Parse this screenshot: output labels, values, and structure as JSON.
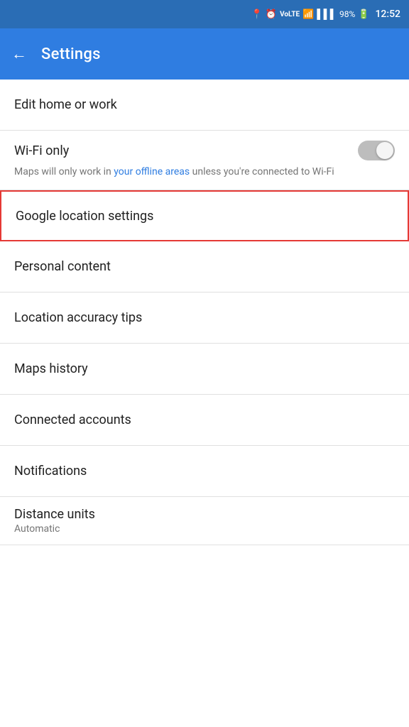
{
  "statusBar": {
    "battery": "98%",
    "time": "12:52"
  },
  "appBar": {
    "title": "Settings",
    "backLabel": "←"
  },
  "menuItems": [
    {
      "id": "edit-home-work",
      "label": "Edit home or work",
      "type": "simple"
    },
    {
      "id": "wifi-only",
      "label": "Wi-Fi only",
      "type": "toggle",
      "description": "Maps will only work in your offline areas unless you're connected to Wi-Fi",
      "descriptionLinkText": "your offline areas",
      "toggleOn": false
    },
    {
      "id": "google-location-settings",
      "label": "Google location settings",
      "type": "highlighted"
    },
    {
      "id": "personal-content",
      "label": "Personal content",
      "type": "simple"
    },
    {
      "id": "location-accuracy-tips",
      "label": "Location accuracy tips",
      "type": "simple"
    },
    {
      "id": "maps-history",
      "label": "Maps history",
      "type": "simple"
    },
    {
      "id": "connected-accounts",
      "label": "Connected accounts",
      "type": "simple"
    },
    {
      "id": "notifications",
      "label": "Notifications",
      "type": "simple"
    },
    {
      "id": "distance-units",
      "label": "Distance units",
      "subLabel": "Automatic",
      "type": "sub"
    }
  ]
}
